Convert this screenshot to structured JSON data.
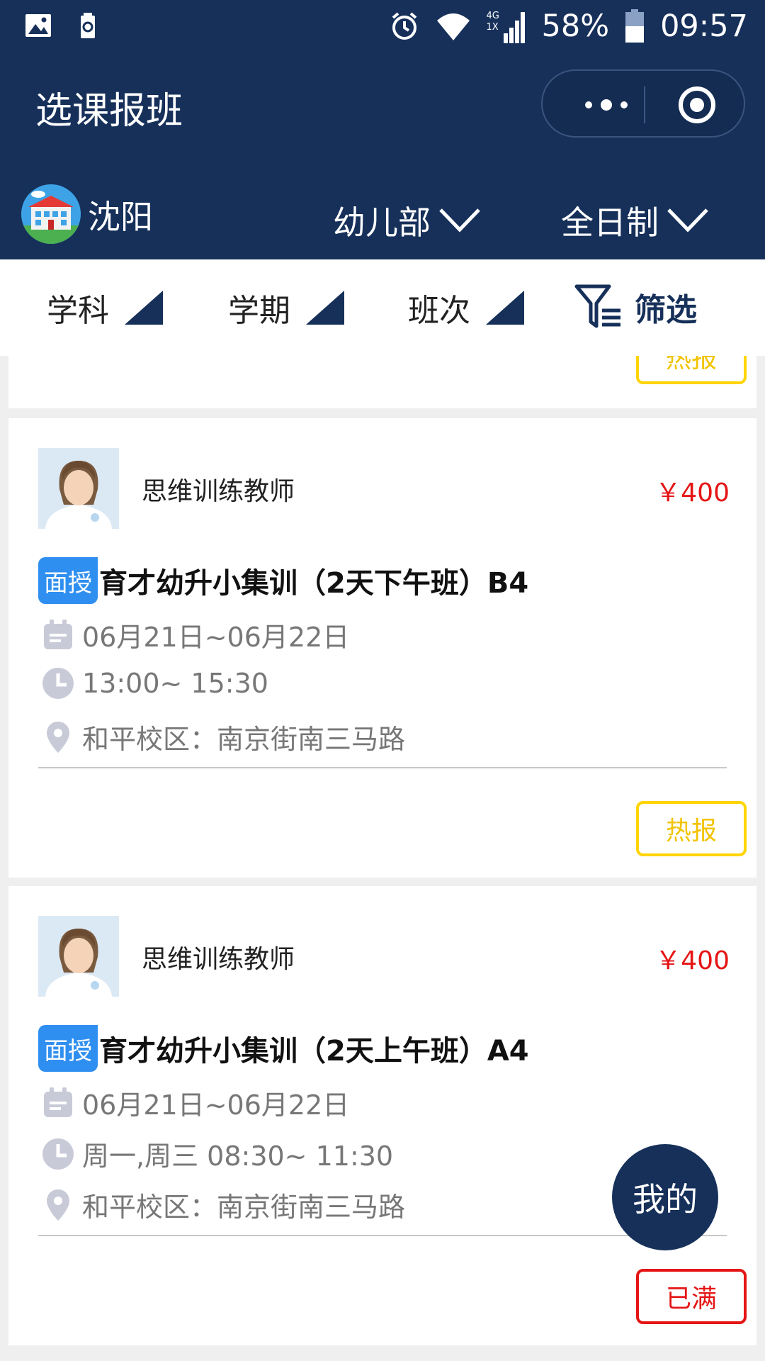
{
  "status_bar": {
    "signal_label": "4G 1X",
    "battery_percent": "58%",
    "time": "09:57"
  },
  "header": {
    "title": "选课报班"
  },
  "selectors": {
    "city": "沈阳",
    "department": "幼儿部",
    "schedule_mode": "全日制"
  },
  "filter_bar": {
    "subject": "学科",
    "term": "学期",
    "class_level": "班次",
    "filter": "筛选"
  },
  "partial_card": {
    "tag": "热报"
  },
  "courses": [
    {
      "teacher": "思维训练教师",
      "price": "￥400",
      "mode": "面授",
      "title": "育才幼升小集训（2天下午班）B4",
      "dates": "06月21日~06月22日",
      "time": "13:00~ 15:30",
      "location": "和平校区：南京街南三马路",
      "tag": "热报",
      "tag_type": "hot"
    },
    {
      "teacher": "思维训练教师",
      "price": "￥400",
      "mode": "面授",
      "title": "育才幼升小集训（2天上午班）A4",
      "dates": "06月21日~06月22日",
      "time": "周一,周三 08:30~ 11:30",
      "location": "和平校区：南京街南三马路",
      "tag": "已满",
      "tag_type": "full"
    }
  ],
  "fab": {
    "label": "我的"
  },
  "colors": {
    "header_bg": "#16305a",
    "price": "#e51515",
    "hot_border": "#ffd400",
    "full_border": "#e51515",
    "mode_badge": "#2f8ff0"
  }
}
